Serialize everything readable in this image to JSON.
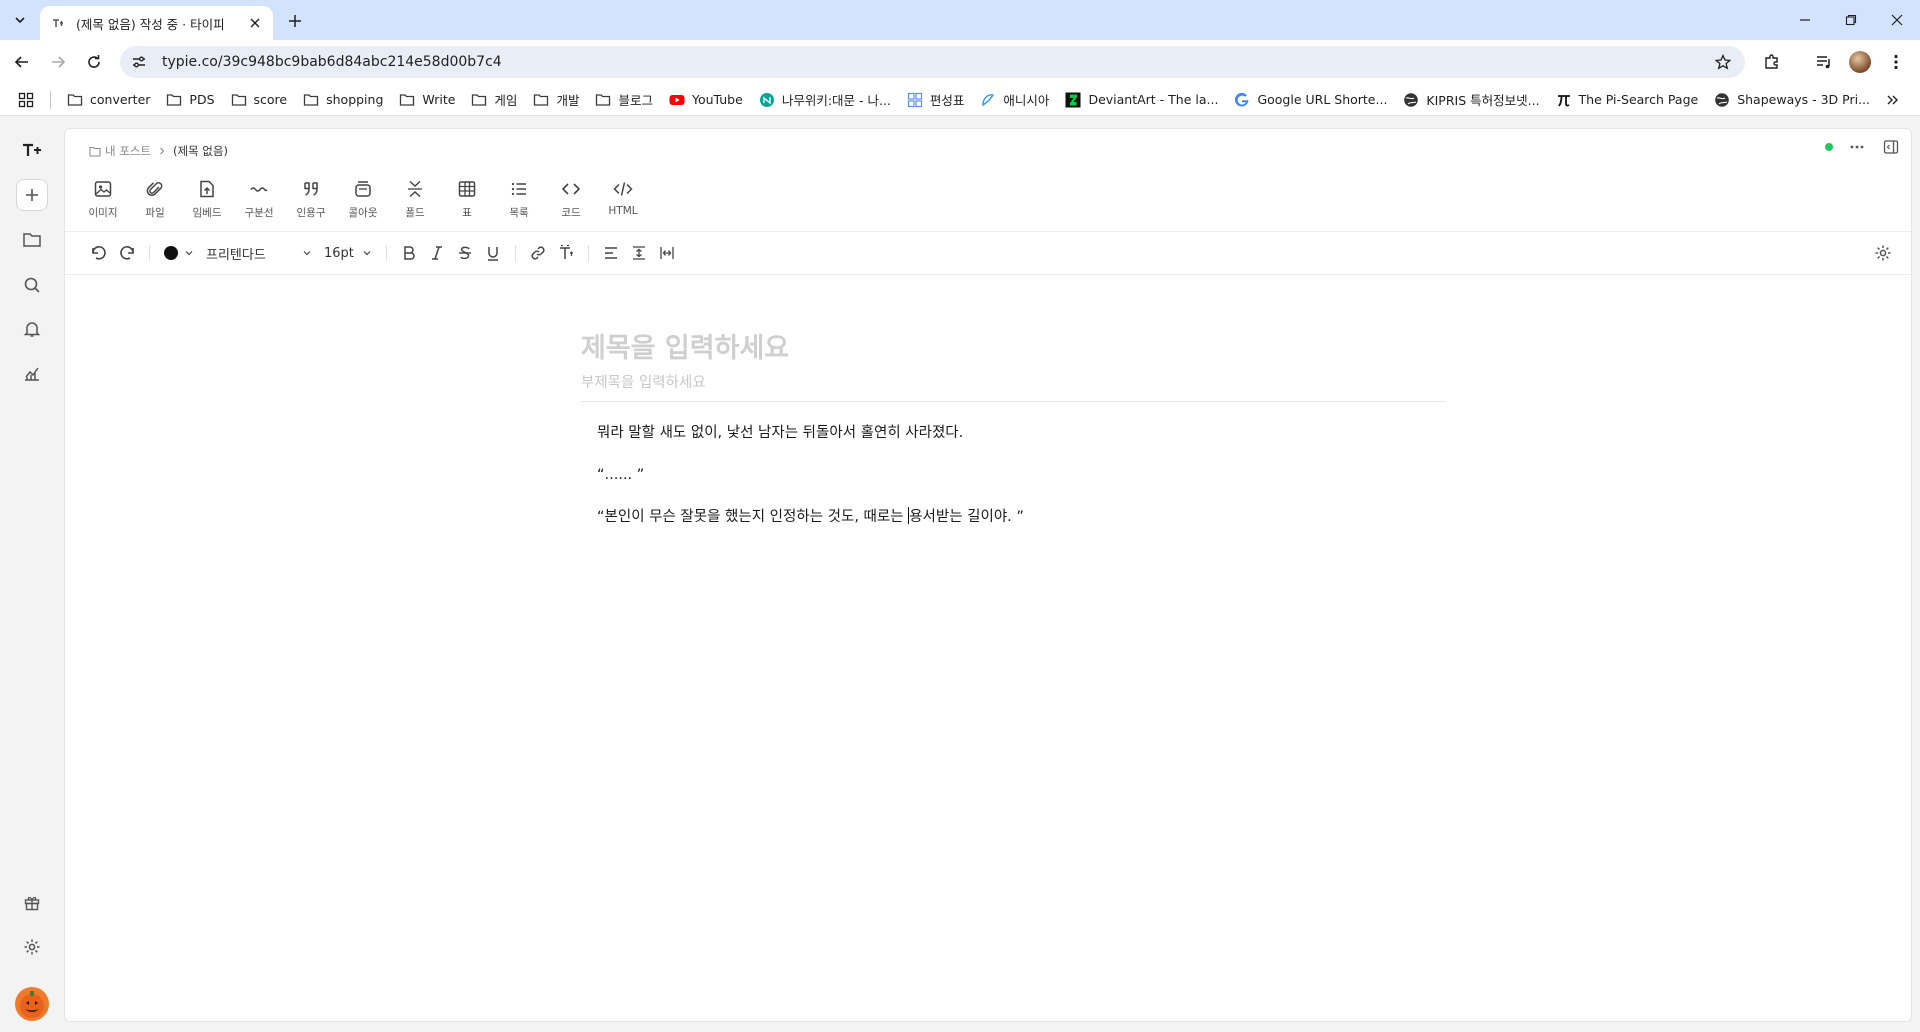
{
  "browser": {
    "tab_title": "(제목 없음) 작성 중 · 타이피",
    "url": "typie.co/39c948bc9bab6d84abc214e58d00b7c4",
    "bookmarks": [
      {
        "label": "converter",
        "icon": "folder-icon"
      },
      {
        "label": "PDS",
        "icon": "folder-icon"
      },
      {
        "label": "score",
        "icon": "folder-icon"
      },
      {
        "label": "shopping",
        "icon": "folder-icon"
      },
      {
        "label": "Write",
        "icon": "folder-icon"
      },
      {
        "label": "게임",
        "icon": "folder-icon"
      },
      {
        "label": "개발",
        "icon": "folder-icon"
      },
      {
        "label": "블로그",
        "icon": "folder-icon"
      },
      {
        "label": "YouTube",
        "icon": "youtube-icon"
      },
      {
        "label": "나무위키:대문 - 나...",
        "icon": "namuwiki-icon"
      },
      {
        "label": "편성표",
        "icon": "grid-icon"
      },
      {
        "label": "애니시아",
        "icon": "anissia-icon"
      },
      {
        "label": "DeviantArt - The la...",
        "icon": "deviantart-icon"
      },
      {
        "label": "Google URL Shorte...",
        "icon": "google-icon"
      },
      {
        "label": "KIPRIS 특허정보넷...",
        "icon": "globe-icon"
      },
      {
        "label": "The Pi-Search Page",
        "icon": "pi-icon"
      },
      {
        "label": "Shapeways - 3D Pri...",
        "icon": "globe-icon"
      }
    ]
  },
  "editor": {
    "breadcrumb": {
      "root": "내 포스트",
      "current": "(제목 없음)"
    },
    "insert_tools": [
      {
        "label": "이미지",
        "icon": "image-icon"
      },
      {
        "label": "파일",
        "icon": "paperclip-icon"
      },
      {
        "label": "임베드",
        "icon": "embed-icon"
      },
      {
        "label": "구분선",
        "icon": "divider-icon"
      },
      {
        "label": "인용구",
        "icon": "quote-icon"
      },
      {
        "label": "콜아웃",
        "icon": "callout-icon"
      },
      {
        "label": "폴드",
        "icon": "fold-icon"
      },
      {
        "label": "표",
        "icon": "table-icon"
      },
      {
        "label": "목록",
        "icon": "list-icon"
      },
      {
        "label": "코드",
        "icon": "code-icon"
      },
      {
        "label": "HTML",
        "icon": "html-icon"
      }
    ],
    "font_family": "프리텐다드",
    "font_size": "16pt",
    "text_color": "#111111",
    "accent_status_color": "#22c55e",
    "title_placeholder": "제목을 입력하세요",
    "subtitle_placeholder": "부제목을 입력하세요",
    "paragraphs": [
      "뭐라 말할 새도 없이, 낯선 남자는 뒤돌아서 홀연히 사라졌다.",
      "“...... ”"
    ],
    "last_paragraph_before_caret": "“본인이 무슨 잘못을 했는지 인정하는 것도, 때로는 ",
    "last_paragraph_after_caret": "용서받는 길이야. ”"
  }
}
